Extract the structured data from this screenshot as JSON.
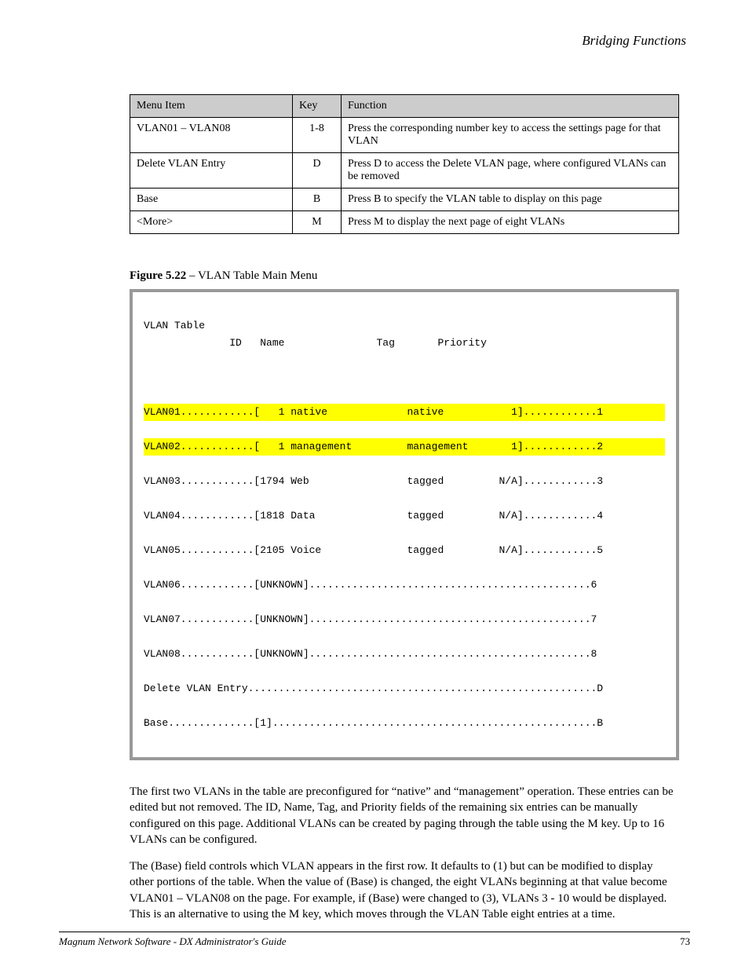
{
  "header": {
    "right": "Bridging Functions"
  },
  "ref_table": {
    "headers": [
      "Menu Item",
      "Key",
      "Function"
    ],
    "rows": [
      {
        "item": "VLAN01 – VLAN08",
        "key": "1-8",
        "func": "Press the corresponding number key to access the settings page for that VLAN"
      },
      {
        "item": "Delete VLAN Entry",
        "key": "D",
        "func": "Press D to access the Delete VLAN page, where configured VLANs can be removed"
      },
      {
        "item": "Base",
        "key": "B",
        "func": "Press B to specify the VLAN table to display on this page"
      },
      {
        "item": "<More>",
        "key": "M",
        "func": "Press M to display the next page of eight VLANs"
      }
    ]
  },
  "figure_title_prefix": "Figure 5.22",
  "figure_title_rest": " – VLAN Table Main Menu",
  "vlan_box": {
    "title": "VLAN Table",
    "col_headers": {
      "id": "ID",
      "name": "Name",
      "tag": "Tag",
      "priority": "Priority"
    },
    "rows": [
      {
        "raw": "VLAN01............[   1 native             native           1]............1",
        "hl": true
      },
      {
        "raw": "VLAN02............[   1 management         management       1]............2",
        "hl": true
      },
      {
        "raw": "VLAN03............[1794 Web                tagged         N/A]............3",
        "hl": false
      },
      {
        "raw": "VLAN04............[1818 Data               tagged         N/A]............4",
        "hl": false
      },
      {
        "raw": "VLAN05............[2105 Voice              tagged         N/A]............5",
        "hl": false
      },
      {
        "raw": "VLAN06............[UNKNOWN]..............................................6",
        "hl": false
      },
      {
        "raw": "VLAN07............[UNKNOWN]..............................................7",
        "hl": false
      },
      {
        "raw": "VLAN08............[UNKNOWN]..............................................8",
        "hl": false
      },
      {
        "raw": "Delete VLAN Entry.........................................................D",
        "hl": false
      },
      {
        "raw": "Base..............[1].....................................................B",
        "hl": false
      }
    ]
  },
  "body_paragraphs": [
    "The first two VLANs in the table are preconfigured for “native” and “management” operation. These entries can be edited but not removed. The ID, Name, Tag, and Priority fields of the remaining six entries can be manually configured on this page. Additional VLANs can be created by paging through the table using the M key. Up to 16 VLANs can be configured.",
    "The (Base) field controls which VLAN appears in the first row. It defaults to (1) but can be modified to display other portions of the table. When the value of (Base) is changed, the eight VLANs beginning at that value become VLAN01 – VLAN08 on the page. For example, if (Base) were changed to (3), VLANs 3 - 10 would be displayed. This is an alternative to using the M key, which moves through the VLAN Table eight entries at a time."
  ],
  "footer": {
    "doc": "Magnum Network Software - DX Administrator's Guide",
    "page": "73"
  }
}
